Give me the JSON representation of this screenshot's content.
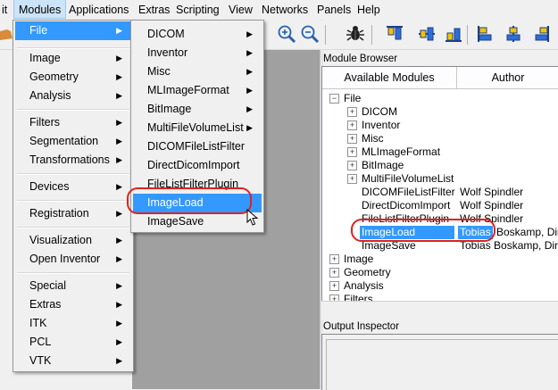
{
  "menubar": {
    "items": [
      "it",
      "Modules",
      "Applications",
      "Extras",
      "Scripting",
      "View",
      "Networks",
      "Panels",
      "Help"
    ]
  },
  "modules_menu": {
    "items": [
      {
        "label": "File",
        "submenu": true
      },
      {
        "label": "Image",
        "submenu": true
      },
      {
        "label": "Geometry",
        "submenu": true
      },
      {
        "label": "Analysis",
        "submenu": true
      },
      {
        "label": "Filters",
        "submenu": true
      },
      {
        "label": "Segmentation",
        "submenu": true
      },
      {
        "label": "Transformations",
        "submenu": true
      },
      {
        "label": "Devices",
        "submenu": true
      },
      {
        "label": "Registration",
        "submenu": true
      },
      {
        "label": "Visualization",
        "submenu": true
      },
      {
        "label": "Open Inventor",
        "submenu": true
      },
      {
        "label": "Special",
        "submenu": true
      },
      {
        "label": "Extras",
        "submenu": true
      },
      {
        "label": "ITK",
        "submenu": true
      },
      {
        "label": "PCL",
        "submenu": true
      },
      {
        "label": "VTK",
        "submenu": true
      }
    ]
  },
  "file_menu": {
    "items": [
      {
        "label": "DICOM",
        "submenu": true
      },
      {
        "label": "Inventor",
        "submenu": true
      },
      {
        "label": "Misc",
        "submenu": true
      },
      {
        "label": "MLImageFormat",
        "submenu": true
      },
      {
        "label": "BitImage",
        "submenu": true
      },
      {
        "label": "MultiFileVolumeList",
        "submenu": true
      },
      {
        "label": "DICOMFileListFilter",
        "submenu": false
      },
      {
        "label": "DirectDicomImport",
        "submenu": false
      },
      {
        "label": "FileListFilterPlugin",
        "submenu": false
      },
      {
        "label": "ImageLoad",
        "submenu": false
      },
      {
        "label": "ImageSave",
        "submenu": false
      }
    ]
  },
  "module_browser": {
    "title": "Module Browser",
    "columns": [
      "Available Modules",
      "Author"
    ],
    "tree": [
      {
        "label": "File",
        "author": "",
        "expander": "−",
        "level": 0
      },
      {
        "label": "DICOM",
        "author": "",
        "expander": "+",
        "level": 1
      },
      {
        "label": "Inventor",
        "author": "",
        "expander": "+",
        "level": 1
      },
      {
        "label": "Misc",
        "author": "",
        "expander": "+",
        "level": 1
      },
      {
        "label": "MLImageFormat",
        "author": "",
        "expander": "+",
        "level": 1
      },
      {
        "label": "BitImage",
        "author": "",
        "expander": "+",
        "level": 1
      },
      {
        "label": "MultiFileVolumeList",
        "author": "",
        "expander": "+",
        "level": 1
      },
      {
        "label": "DICOMFileListFilter",
        "author": "Wolf Spindler",
        "expander": "",
        "level": 1
      },
      {
        "label": "DirectDicomImport",
        "author": "Wolf Spindler",
        "expander": "",
        "level": 1
      },
      {
        "label": "FileListFilterPlugin",
        "author": "Wolf Spindler",
        "expander": "",
        "level": 1
      },
      {
        "label": "ImageLoad",
        "author_sel": "Tobias",
        "author_rest": " Boskamp, Dirk",
        "expander": "",
        "level": 1
      },
      {
        "label": "ImageSave",
        "author": "Tobias Boskamp, Dirk",
        "expander": "",
        "level": 1
      },
      {
        "label": "Image",
        "author": "",
        "expander": "+",
        "level": 0
      },
      {
        "label": "Geometry",
        "author": "",
        "expander": "+",
        "level": 0
      },
      {
        "label": "Analysis",
        "author": "",
        "expander": "+",
        "level": 0
      },
      {
        "label": "Filters",
        "author": "",
        "expander": "+",
        "level": 0
      }
    ]
  },
  "output_inspector": {
    "title": "Output Inspector"
  },
  "colors": {
    "highlight": "#3399ff",
    "annotation": "#e0211f",
    "menubar_active": "#cce4f7"
  }
}
